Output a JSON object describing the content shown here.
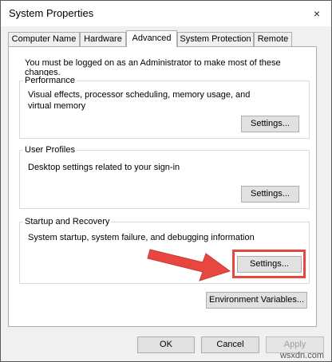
{
  "window": {
    "title": "System Properties",
    "close_icon": "×"
  },
  "tabs": [
    "Computer Name",
    "Hardware",
    "Advanced",
    "System Protection",
    "Remote"
  ],
  "panel": {
    "admin_notice": "You must be logged on as an Administrator to make most of these changes.",
    "performance": {
      "title": "Performance",
      "description": "Visual effects, processor scheduling, memory usage, and virtual memory",
      "button": "Settings..."
    },
    "user_profiles": {
      "title": "User Profiles",
      "description": "Desktop settings related to your sign-in",
      "button": "Settings..."
    },
    "startup_recovery": {
      "title": "Startup and Recovery",
      "description": "System startup, system failure, and debugging information",
      "button": "Settings..."
    },
    "env_button": "Environment Variables..."
  },
  "footer": {
    "ok": "OK",
    "cancel": "Cancel",
    "apply": "Apply"
  },
  "annotation": {
    "color": "#e8473f",
    "arrow_icon": "arrow-right-icon"
  },
  "watermark": "wsxdn.com"
}
